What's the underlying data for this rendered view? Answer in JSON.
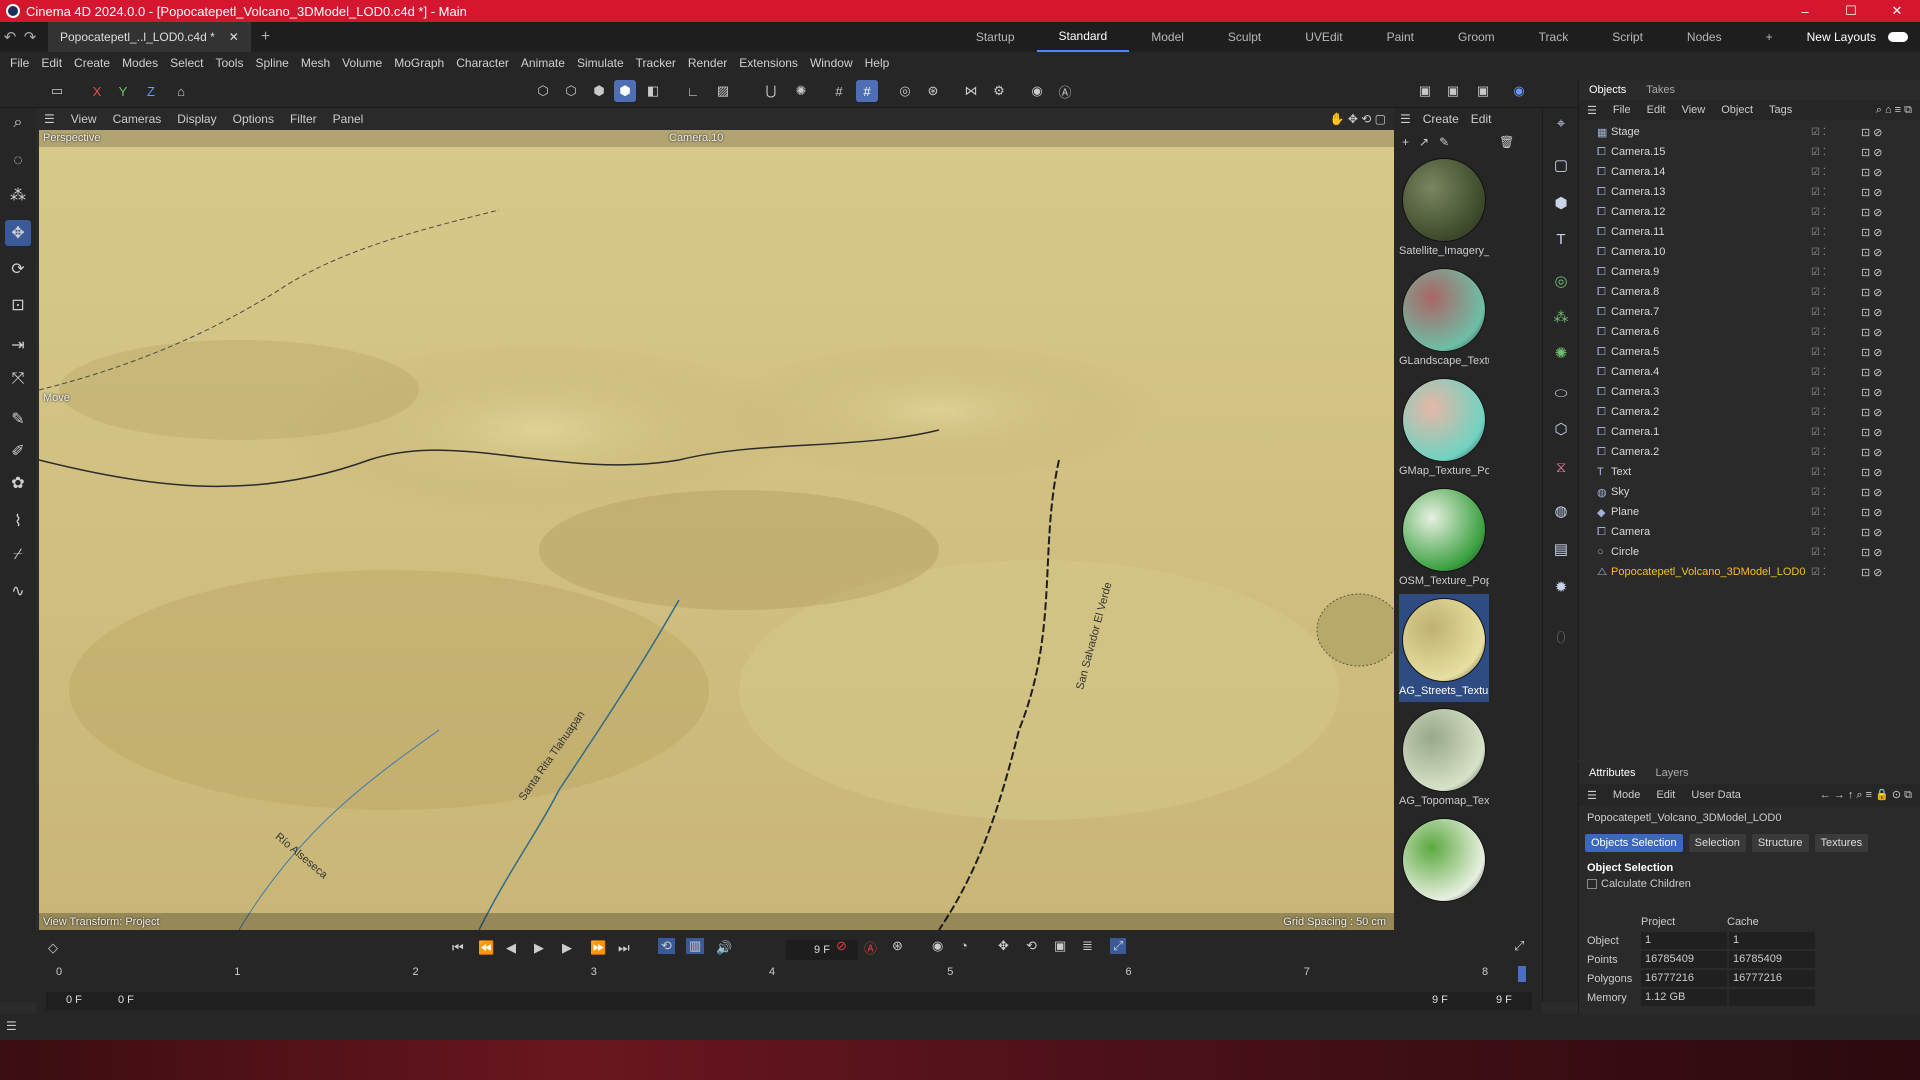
{
  "window": {
    "title": "Cinema 4D 2024.0.0 - [Popocatepetl_Volcano_3DModel_LOD0.c4d *] - Main",
    "min": "–",
    "max": "☐",
    "close": "✕"
  },
  "tabs": {
    "doc_tab": "Popocatepetl_..l_LOD0.c4d *",
    "doc_close": "✕",
    "add": "+"
  },
  "layouts": {
    "items": [
      "Startup",
      "Standard",
      "Model",
      "Sculpt",
      "UVEdit",
      "Paint",
      "Groom",
      "Track",
      "Script",
      "Nodes"
    ],
    "active": "Standard",
    "add": "+",
    "new_layouts": "New Layouts"
  },
  "menubar": [
    "File",
    "Edit",
    "Create",
    "Modes",
    "Select",
    "Tools",
    "Spline",
    "Mesh",
    "Volume",
    "MoGraph",
    "Character",
    "Animate",
    "Simulate",
    "Tracker",
    "Render",
    "Extensions",
    "Window",
    "Help"
  ],
  "toolbar": {
    "axes": [
      "X",
      "Y",
      "Z"
    ]
  },
  "viewport": {
    "menu": [
      "View",
      "Cameras",
      "Display",
      "Options",
      "Filter",
      "Panel"
    ],
    "perspective_label": "Perspective",
    "camera_label": "Camera.10",
    "move_label": "Move",
    "view_transform": "View Transform: Project",
    "grid_spacing": "Grid Spacing : 50 cm",
    "road_labels": [
      "San Salvador El Verde",
      "Río Alseseca",
      "Santa Rita Tlahuapan"
    ]
  },
  "materials": {
    "menu": [
      "Create",
      "Edit"
    ],
    "items": [
      {
        "name": "Satellite_Imagery_",
        "c1": "#3d4a2a",
        "c2": "#7a8660"
      },
      {
        "name": "GLandscape_Textu",
        "c1": "#6dbfa6",
        "c2": "#a66"
      },
      {
        "name": "GMap_Texture_Po",
        "c1": "#6fd3c0",
        "c2": "#e7b7a8"
      },
      {
        "name": "OSM_Texture_Pop",
        "c1": "#3aa040",
        "c2": "#e8f0e0"
      },
      {
        "name": "AG_Streets_Textur",
        "c1": "#e7e0a0",
        "c2": "#bfb070"
      },
      {
        "name": "AG_Topomap_Tex",
        "c1": "#d8e2c8",
        "c2": "#98a888"
      },
      {
        "name": "",
        "c1": "#e8f0e0",
        "c2": "#5ca840"
      }
    ],
    "selected": "AG_Streets_Textur"
  },
  "objects": {
    "tabs": [
      "Objects",
      "Takes"
    ],
    "menu": [
      "File",
      "Edit",
      "View",
      "Object",
      "Tags"
    ],
    "rows": [
      {
        "name": "Stage",
        "icon": "stage-icon"
      },
      {
        "name": "Camera.15",
        "icon": "camera-icon"
      },
      {
        "name": "Camera.14",
        "icon": "camera-icon"
      },
      {
        "name": "Camera.13",
        "icon": "camera-icon"
      },
      {
        "name": "Camera.12",
        "icon": "camera-icon"
      },
      {
        "name": "Camera.11",
        "icon": "camera-icon"
      },
      {
        "name": "Camera.10",
        "icon": "camera-icon"
      },
      {
        "name": "Camera.9",
        "icon": "camera-icon"
      },
      {
        "name": "Camera.8",
        "icon": "camera-icon"
      },
      {
        "name": "Camera.7",
        "icon": "camera-icon"
      },
      {
        "name": "Camera.6",
        "icon": "camera-icon"
      },
      {
        "name": "Camera.5",
        "icon": "camera-icon"
      },
      {
        "name": "Camera.4",
        "icon": "camera-icon"
      },
      {
        "name": "Camera.3",
        "icon": "camera-icon"
      },
      {
        "name": "Camera.2",
        "icon": "camera-icon"
      },
      {
        "name": "Camera.1",
        "icon": "camera-icon"
      },
      {
        "name": "Camera.2",
        "icon": "camera-icon"
      },
      {
        "name": "Text",
        "icon": "text-icon"
      },
      {
        "name": "Sky",
        "icon": "sky-icon"
      },
      {
        "name": "Plane",
        "icon": "plane-icon"
      },
      {
        "name": "Camera",
        "icon": "camera-icon"
      },
      {
        "name": "Circle",
        "icon": "circle-icon"
      },
      {
        "name": "Popocatepetl_Volcano_3DModel_LOD0",
        "icon": "mesh-icon"
      }
    ]
  },
  "attributes": {
    "tabs": [
      "Attributes",
      "Layers"
    ],
    "menu": [
      "Mode",
      "Edit",
      "User Data"
    ],
    "object_name": "Popocatepetl_Volcano_3DModel_LOD0",
    "buttons": [
      "Objects Selection",
      "Selection",
      "Structure",
      "Textures"
    ],
    "active_button": "Objects Selection",
    "section": "Object Selection",
    "calc_children": "Calculate Children",
    "col_headers": [
      "Project",
      "Cache"
    ],
    "stats": [
      {
        "label": "Object",
        "project": "1",
        "cache": "1"
      },
      {
        "label": "Points",
        "project": "16785409",
        "cache": "16785409"
      },
      {
        "label": "Polygons",
        "project": "16777216",
        "cache": "16777216"
      },
      {
        "label": "Memory",
        "project": "1.12 GB",
        "cache": ""
      }
    ]
  },
  "timeline": {
    "current_frame": "9 F",
    "ruler_ticks": [
      "0",
      "1",
      "2",
      "3",
      "4",
      "5",
      "6",
      "7",
      "8"
    ],
    "start": "0 F",
    "start2": "0 F",
    "end": "9 F",
    "end2": "9 F"
  },
  "colors": {
    "title_red": "#d4162e",
    "accent_blue": "#4b89ff",
    "selected_gold": "#f0c020"
  }
}
